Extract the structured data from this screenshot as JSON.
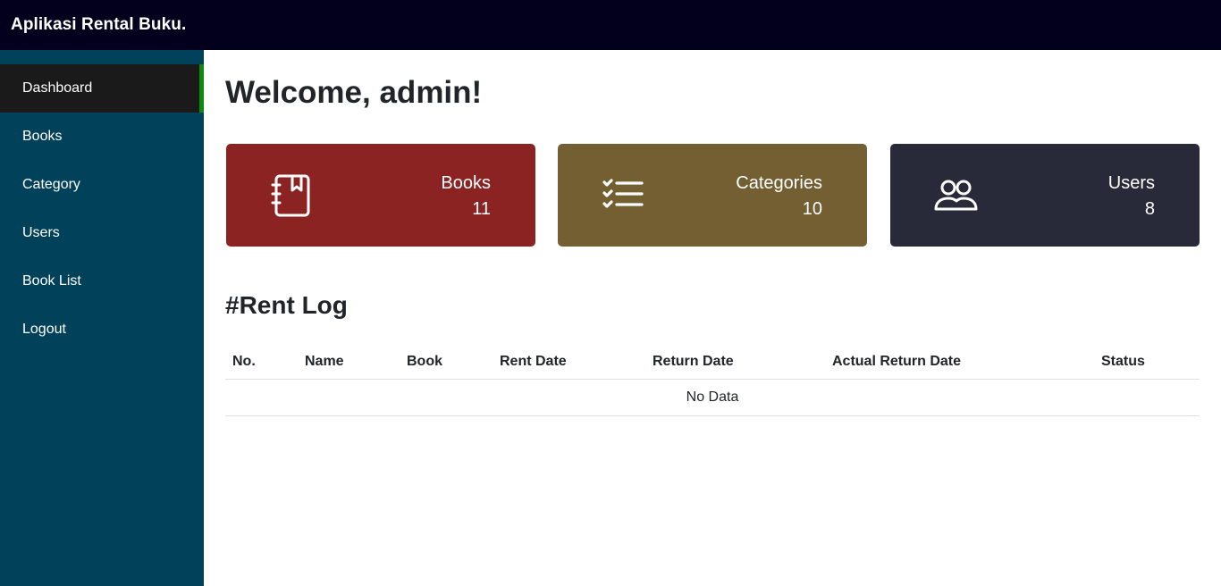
{
  "navbar": {
    "brand": "Aplikasi Rental Buku."
  },
  "sidebar": {
    "items": [
      {
        "label": "Dashboard",
        "active": true
      },
      {
        "label": "Books"
      },
      {
        "label": "Category"
      },
      {
        "label": "Users"
      },
      {
        "label": "Book List"
      },
      {
        "label": "Logout"
      }
    ],
    "active_color": "#1a1a1a",
    "active_indicator_color": "#0d8a0d"
  },
  "main": {
    "welcome": "Welcome, admin!",
    "cards": [
      {
        "label": "Books",
        "count": "11",
        "icon": "book-icon",
        "color": "#8b2323"
      },
      {
        "label": "Categories",
        "count": "10",
        "icon": "list-icon",
        "color": "#735f32"
      },
      {
        "label": "Users",
        "count": "8",
        "icon": "users-icon",
        "color": "#282a3a"
      }
    ],
    "rent_log": {
      "title": "#Rent Log",
      "columns": [
        "No.",
        "Name",
        "Book",
        "Rent Date",
        "Return Date",
        "Actual Return Date",
        "Status"
      ],
      "empty_text": "No Data"
    }
  }
}
